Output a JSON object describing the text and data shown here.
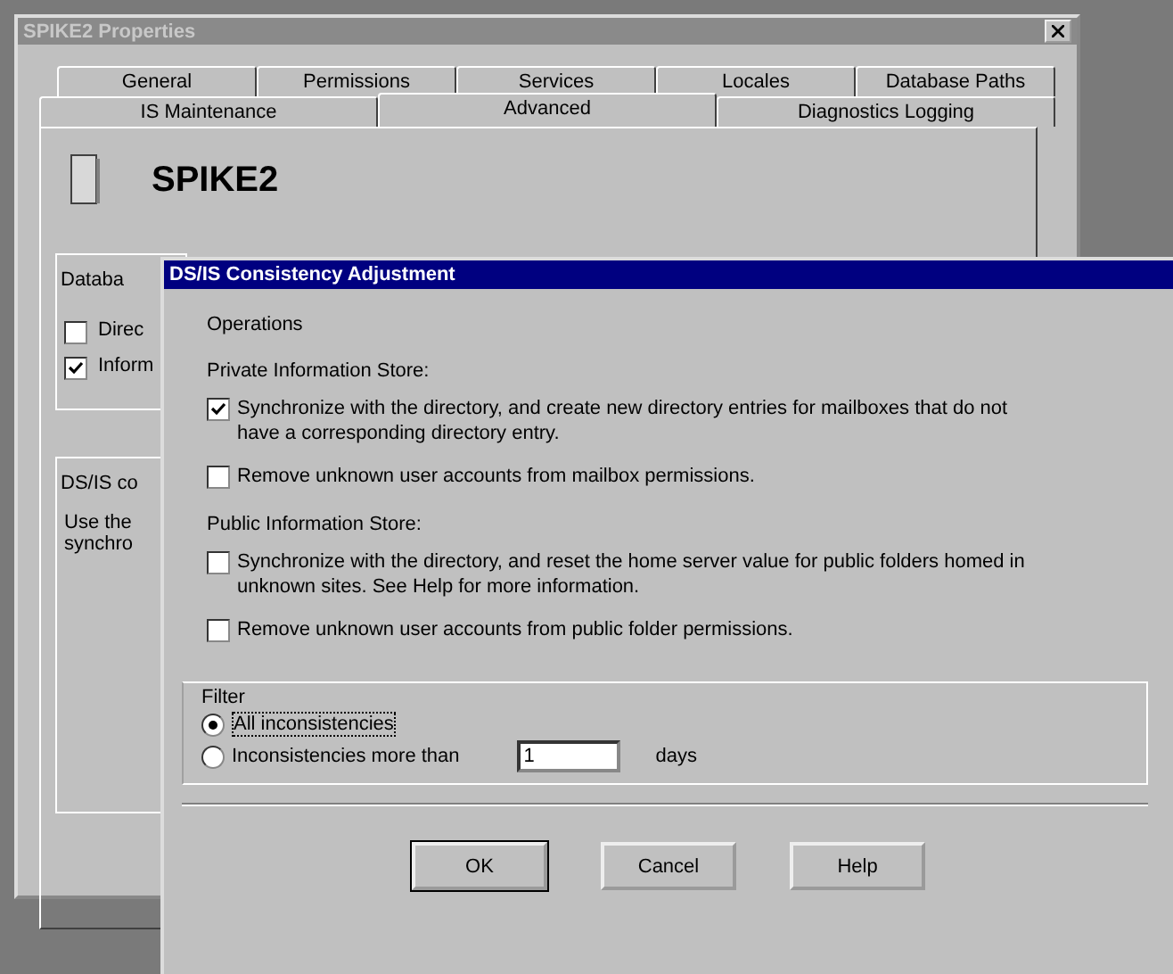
{
  "main_window": {
    "title": "SPIKE2 Properties",
    "tab_rows": [
      [
        {
          "label": "General",
          "selected": false
        },
        {
          "label": "Permissions",
          "selected": false
        },
        {
          "label": "Services",
          "selected": false
        },
        {
          "label": "Locales",
          "selected": false
        },
        {
          "label": "Database Paths",
          "selected": false
        }
      ],
      [
        {
          "label": "IS Maintenance",
          "selected": false
        },
        {
          "label": "Advanced",
          "selected": true
        },
        {
          "label": "Diagnostics Logging",
          "selected": false
        }
      ]
    ],
    "server_name": "SPIKE2",
    "database_group": {
      "title": "Databa",
      "checkboxes": [
        {
          "label": "Direc",
          "checked": false
        },
        {
          "label": "Inform",
          "checked": true
        }
      ]
    },
    "consistency_group": {
      "title": "DS/IS co",
      "lines": [
        "Use the",
        "synchro"
      ]
    }
  },
  "dialog": {
    "title": "DS/IS Consistency Adjustment",
    "section_title": "Operations",
    "stores": [
      {
        "heading": "Private Information Store:",
        "options": [
          {
            "label": "Synchronize with the directory, and create new directory entries for mailboxes that do not have a corresponding directory entry.",
            "checked": true
          },
          {
            "label": "Remove unknown user accounts from mailbox permissions.",
            "checked": false
          }
        ]
      },
      {
        "heading": "Public Information Store:",
        "options": [
          {
            "label": "Synchronize with the directory, and reset the home server value for public folders homed in unknown sites. See Help for more information.",
            "checked": false
          },
          {
            "label": "Remove unknown user accounts from public folder permissions.",
            "checked": false
          }
        ]
      }
    ],
    "filter": {
      "title": "Filter",
      "options": [
        {
          "label": "All inconsistencies",
          "selected": true
        },
        {
          "label": "Inconsistencies more than",
          "selected": false
        }
      ],
      "days_value": "1",
      "days_unit": "days"
    },
    "buttons": [
      "OK",
      "Cancel",
      "Help"
    ]
  }
}
